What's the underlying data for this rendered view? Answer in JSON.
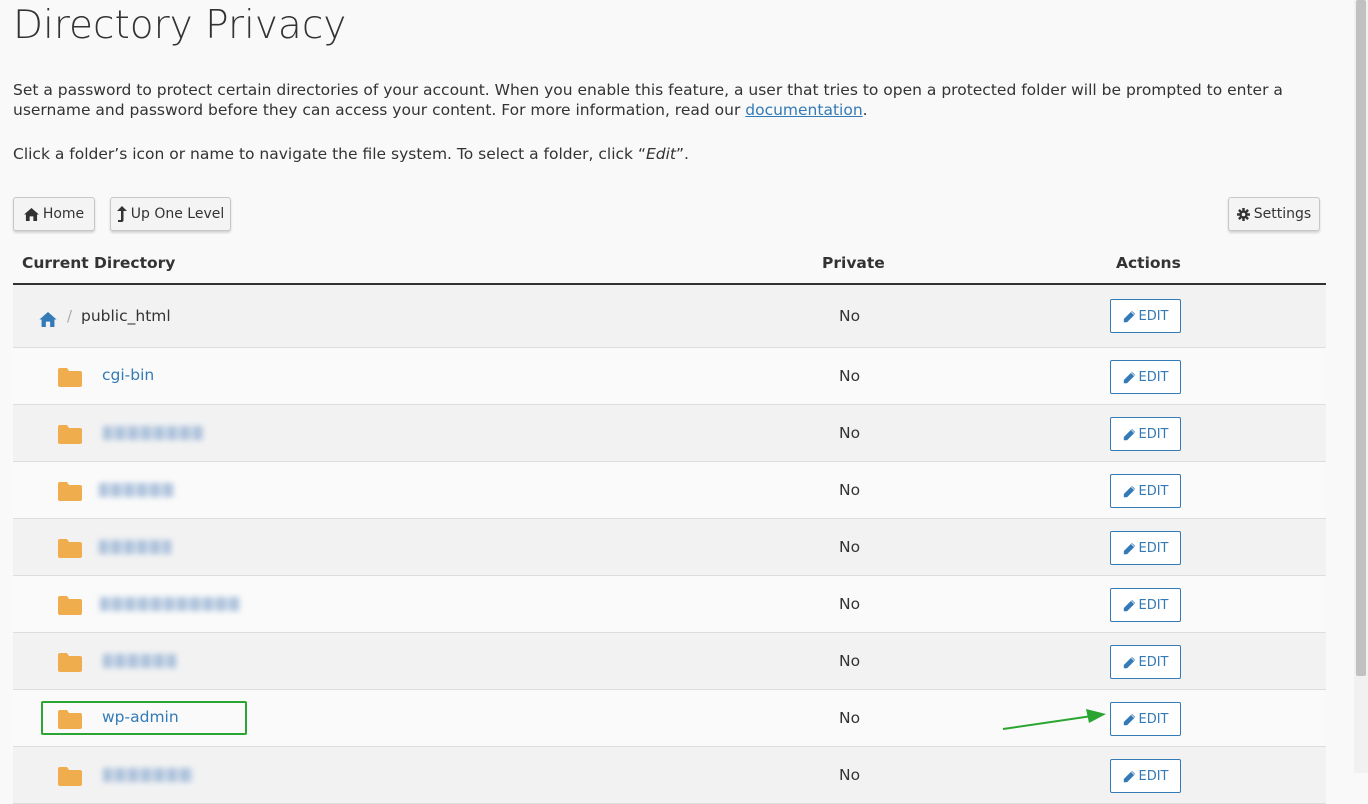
{
  "page": {
    "title": "Directory Privacy",
    "intro_text": "Set a password to protect certain directories of your account. When you enable this feature, a user that tries to open a protected folder will be prompted to enter a username and password before they can access your content. For more information, read our ",
    "intro_link": "documentation",
    "intro_end": ".",
    "hint_prefix": "Click a folder’s icon or name to navigate the file system. To select a folder, click “",
    "hint_em": "Edit",
    "hint_suffix": "”."
  },
  "toolbar": {
    "home_label": "Home",
    "up_label": "Up One Level",
    "settings_label": "Settings"
  },
  "table": {
    "headers": {
      "directory": "Current Directory",
      "private": "Private",
      "actions": "Actions"
    },
    "current_dir": {
      "name": "public_html",
      "private": "No",
      "action": "EDIT"
    },
    "rows": [
      {
        "name": "cgi-bin",
        "private": "No",
        "action": "EDIT"
      },
      {
        "name": "",
        "private": "No",
        "action": "EDIT"
      },
      {
        "name": "",
        "private": "No",
        "action": "EDIT"
      },
      {
        "name": "",
        "private": "No",
        "action": "EDIT"
      },
      {
        "name": "",
        "private": "No",
        "action": "EDIT"
      },
      {
        "name": "",
        "private": "No",
        "action": "EDIT"
      },
      {
        "name": "wp-admin",
        "private": "No",
        "action": "EDIT"
      },
      {
        "name": "",
        "private": "No",
        "action": "EDIT"
      }
    ]
  },
  "colors": {
    "link": "#337ab7",
    "folder": "#f0ad4e",
    "annotation": "#2ba532"
  },
  "icons": {
    "home": "home-icon",
    "up": "level-up-icon",
    "settings": "gear-icon",
    "edit": "pencil-icon",
    "folder": "folder-icon"
  }
}
